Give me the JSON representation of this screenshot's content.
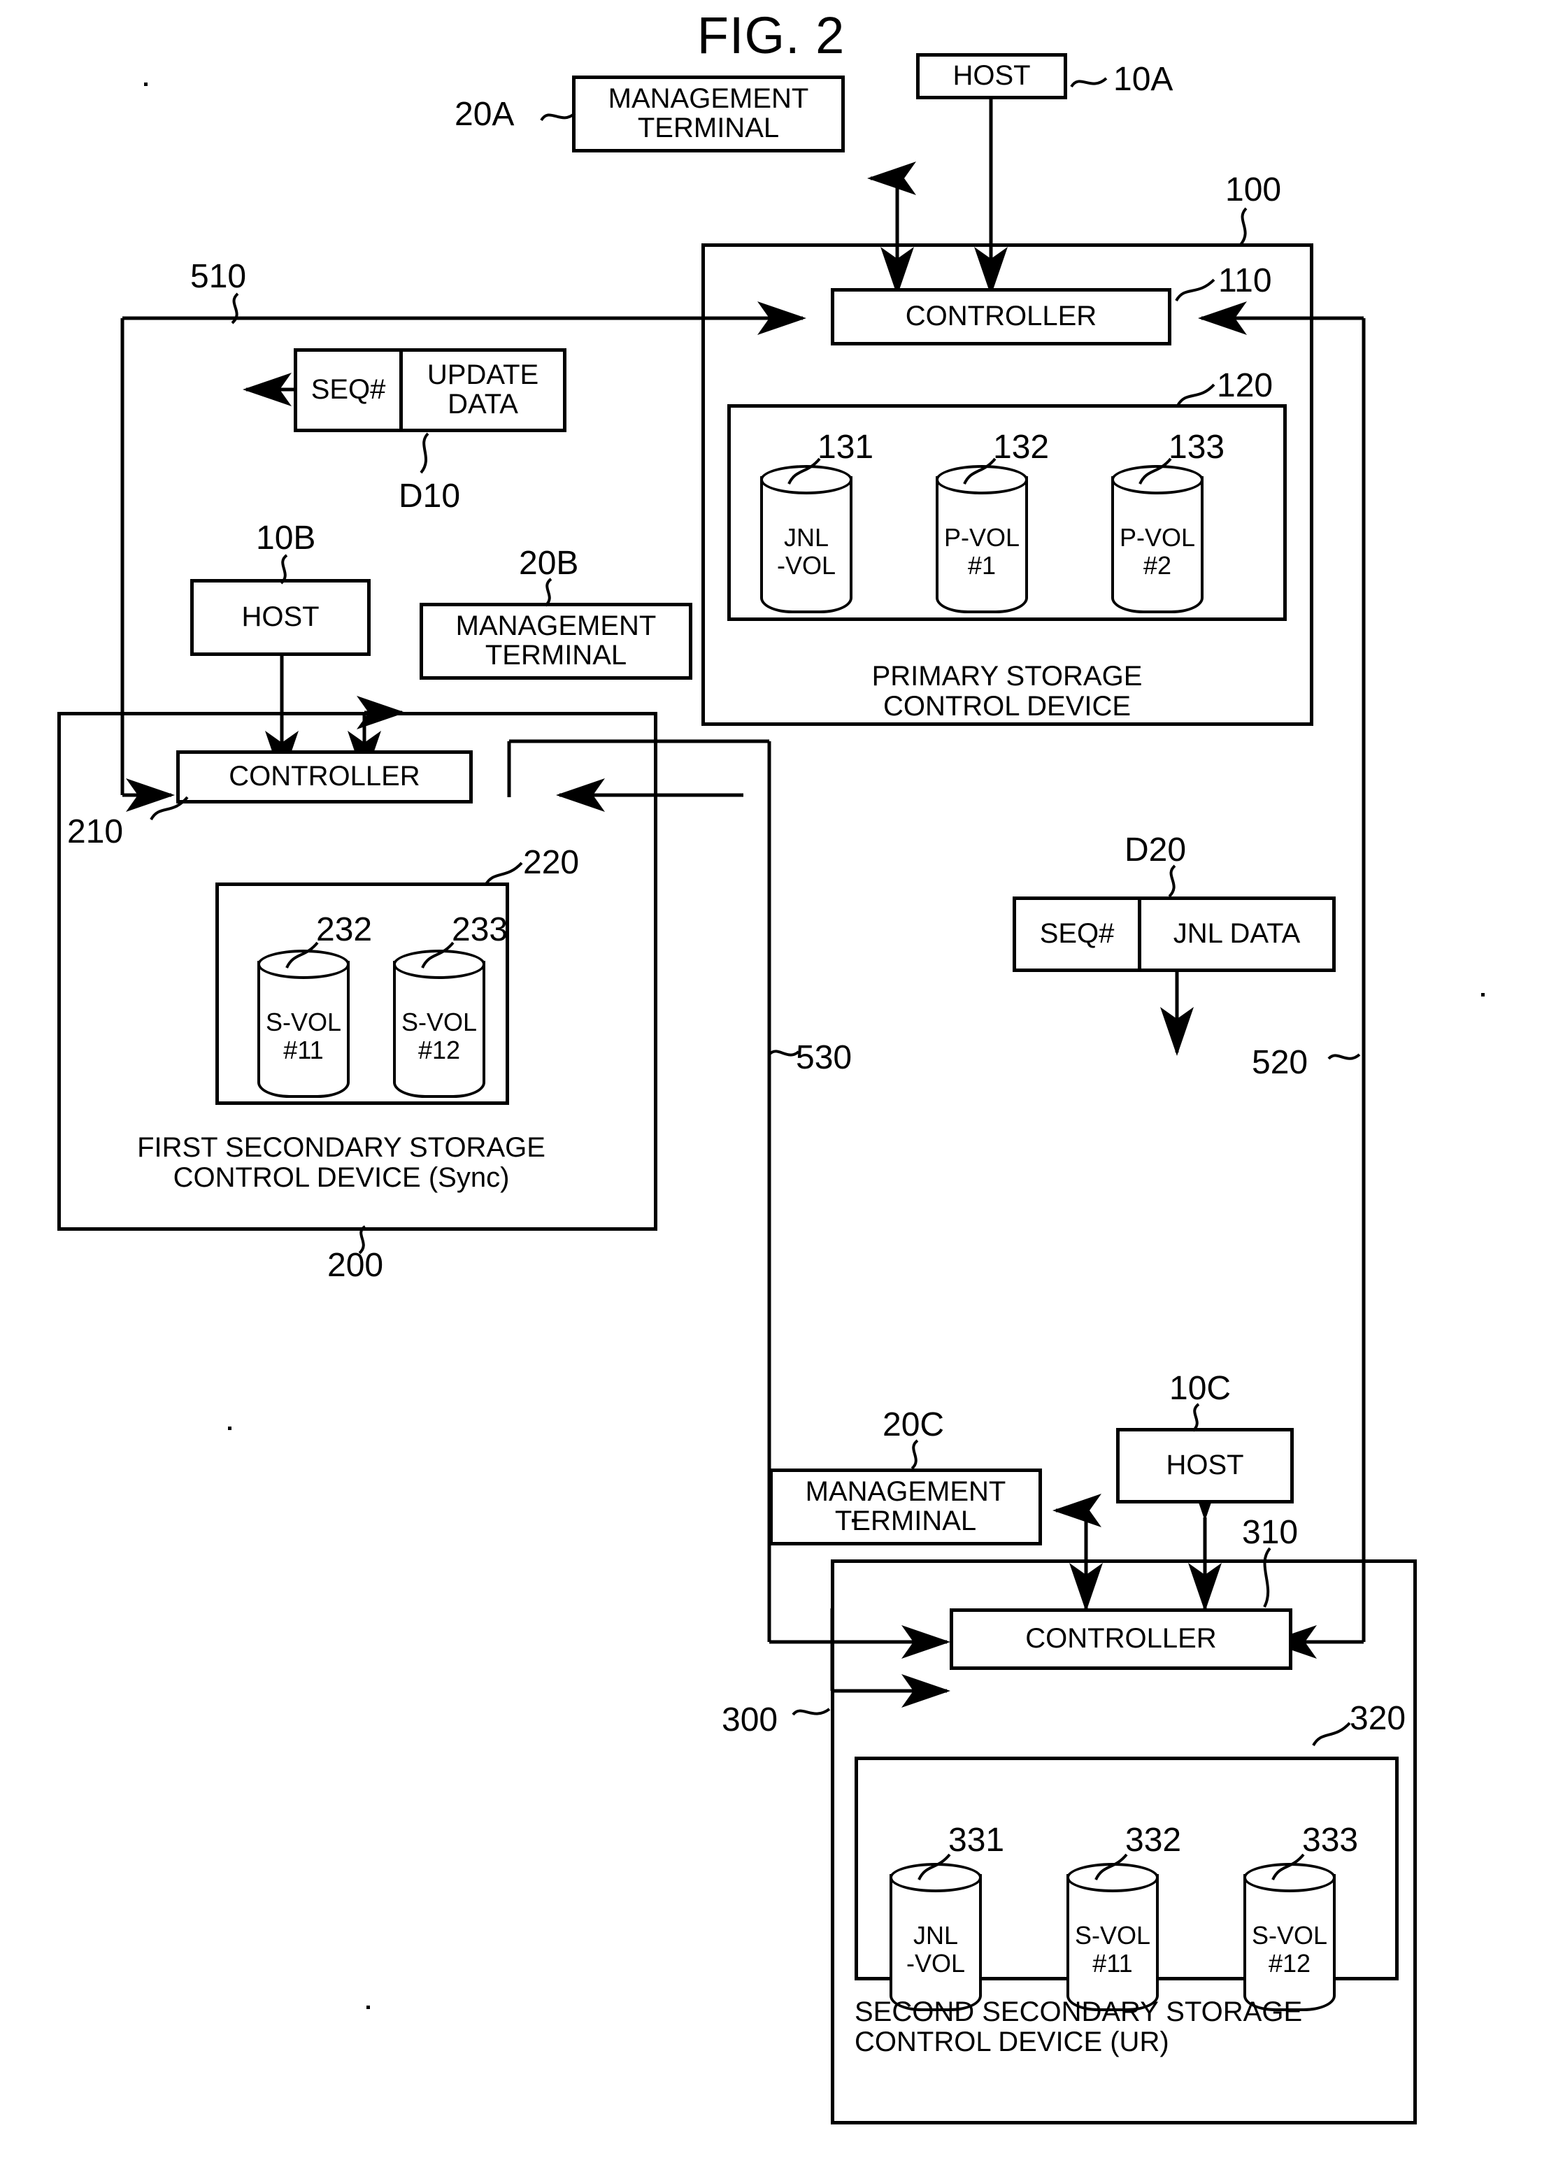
{
  "figure": {
    "title": "FIG. 2"
  },
  "primary_site": {
    "host": {
      "label": "HOST",
      "ref": "10A"
    },
    "management_terminal": {
      "label": "MANAGEMENT\nTERMINAL",
      "ref": "20A"
    },
    "device": {
      "ref": "100",
      "caption": "PRIMARY STORAGE\nCONTROL DEVICE",
      "controller": {
        "label": "CONTROLLER",
        "ref": "110"
      },
      "volume_group_ref": "120",
      "volumes": [
        {
          "label": "JNL\n-VOL",
          "ref": "131"
        },
        {
          "label": "P-VOL\n#1",
          "ref": "132"
        },
        {
          "label": "P-VOL\n#2",
          "ref": "133"
        }
      ]
    }
  },
  "first_secondary_site": {
    "host": {
      "label": "HOST",
      "ref": "10B"
    },
    "management_terminal": {
      "label": "MANAGEMENT\nTERMINAL",
      "ref": "20B"
    },
    "device": {
      "ref": "200",
      "caption": "FIRST SECONDARY STORAGE\nCONTROL DEVICE (Sync)",
      "controller": {
        "label": "CONTROLLER",
        "ref": "210"
      },
      "volume_group_ref": "220",
      "volumes": [
        {
          "label": "S-VOL\n#11",
          "ref": "232"
        },
        {
          "label": "S-VOL\n#12",
          "ref": "233"
        }
      ]
    }
  },
  "second_secondary_site": {
    "host": {
      "label": "HOST",
      "ref": "10C"
    },
    "management_terminal": {
      "label": "MANAGEMENT\nTERMINAL",
      "ref": "20C"
    },
    "device": {
      "ref": "300",
      "caption": "SECOND SECONDARY STORAGE\nCONTROL DEVICE (UR)",
      "controller": {
        "label": "CONTROLLER",
        "ref": "310"
      },
      "volume_group_ref": "320",
      "volumes": [
        {
          "label": "JNL\n-VOL",
          "ref": "331"
        },
        {
          "label": "S-VOL\n#11",
          "ref": "332"
        },
        {
          "label": "S-VOL\n#12",
          "ref": "333"
        }
      ]
    }
  },
  "data_packets": [
    {
      "ref": "D10",
      "seq_label": "SEQ#",
      "payload_label": "UPDATE\nDATA"
    },
    {
      "ref": "D20",
      "seq_label": "SEQ#",
      "payload_label": "JNL DATA"
    }
  ],
  "paths": [
    {
      "ref": "510"
    },
    {
      "ref": "520"
    },
    {
      "ref": "530"
    }
  ]
}
